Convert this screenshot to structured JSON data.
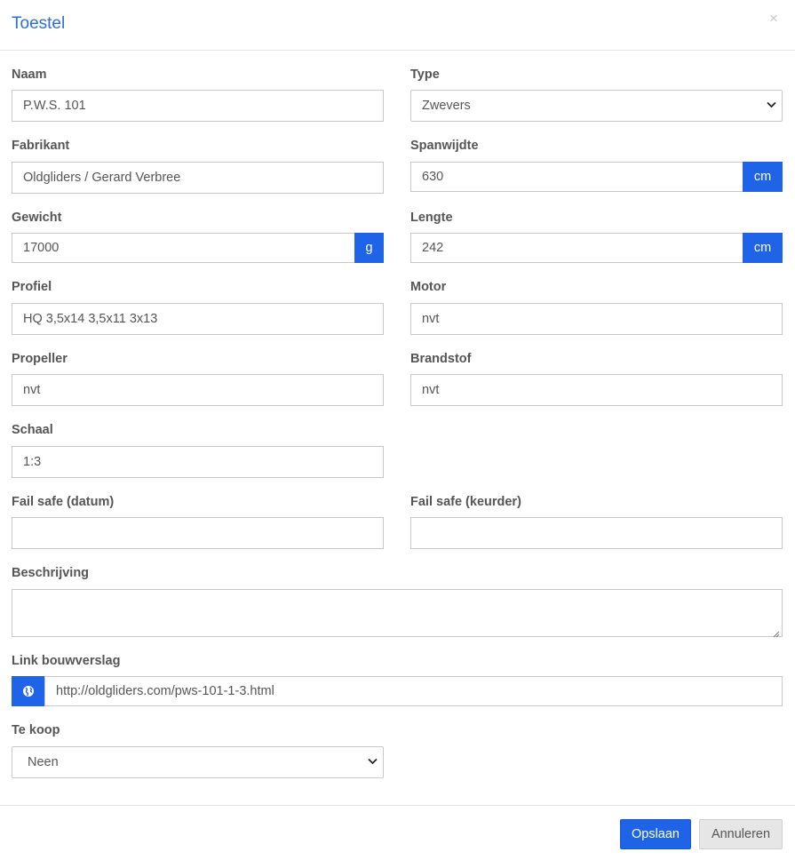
{
  "modal": {
    "title": "Toestel"
  },
  "fields": {
    "naam": {
      "label": "Naam",
      "value": "P.W.S. 101"
    },
    "type": {
      "label": "Type",
      "value": "Zwevers"
    },
    "fabrikant": {
      "label": "Fabrikant",
      "value": "Oldgliders / Gerard Verbree"
    },
    "spanwijdte": {
      "label": "Spanwijdte",
      "value": "630",
      "unit": "cm"
    },
    "gewicht": {
      "label": "Gewicht",
      "value": "17000",
      "unit": "g"
    },
    "lengte": {
      "label": "Lengte",
      "value": "242",
      "unit": "cm"
    },
    "profiel": {
      "label": "Profiel",
      "value": "HQ 3,5x14 3,5x11 3x13"
    },
    "motor": {
      "label": "Motor",
      "value": "nvt"
    },
    "propeller": {
      "label": "Propeller",
      "value": "nvt"
    },
    "brandstof": {
      "label": "Brandstof",
      "value": "nvt"
    },
    "schaal": {
      "label": "Schaal",
      "value": "1:3"
    },
    "failsafe_datum": {
      "label": "Fail safe (datum)",
      "value": ""
    },
    "failsafe_keurder": {
      "label": "Fail safe (keurder)",
      "value": ""
    },
    "beschrijving": {
      "label": "Beschrijving",
      "value": ""
    },
    "link": {
      "label": "Link bouwverslag",
      "value": "http://oldgliders.com/pws-101-1-3.html",
      "icon": "globe-icon"
    },
    "te_koop": {
      "label": "Te koop",
      "value": "Neen"
    }
  },
  "footer": {
    "save_label": "Opslaan",
    "cancel_label": "Annuleren"
  },
  "colors": {
    "accent": "#1f63e8",
    "title": "#2a6fd6"
  }
}
